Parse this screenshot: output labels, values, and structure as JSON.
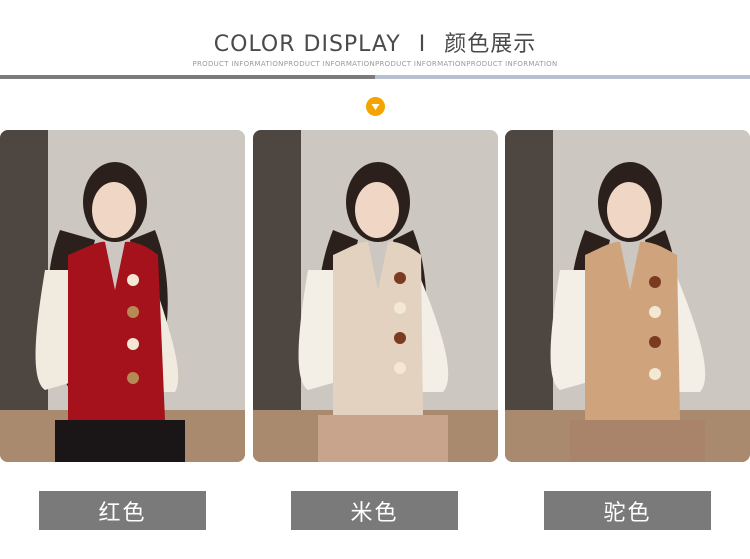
{
  "header": {
    "title_en": "COLOR DISPLAY",
    "separator": "I",
    "title_cn": "颜色展示",
    "subtitle": "PRODUCT INFORMATIONPRODUCT INFORMATIONPRODUCT INFORMATIONPRODUCT INFORMATION"
  },
  "colors": {
    "divider_dark": "#7b7b7b",
    "divider_light": "#b8bfd1",
    "badge": "#f5a300",
    "label_bg": "#7a7a7a"
  },
  "icons": {
    "badge": "chevron-down-icon"
  },
  "products": [
    {
      "label": "红色",
      "vest_color": "#a5121b"
    },
    {
      "label": "米色",
      "vest_color": "#e3d2c0"
    },
    {
      "label": "驼色",
      "vest_color": "#cfa47c"
    }
  ]
}
